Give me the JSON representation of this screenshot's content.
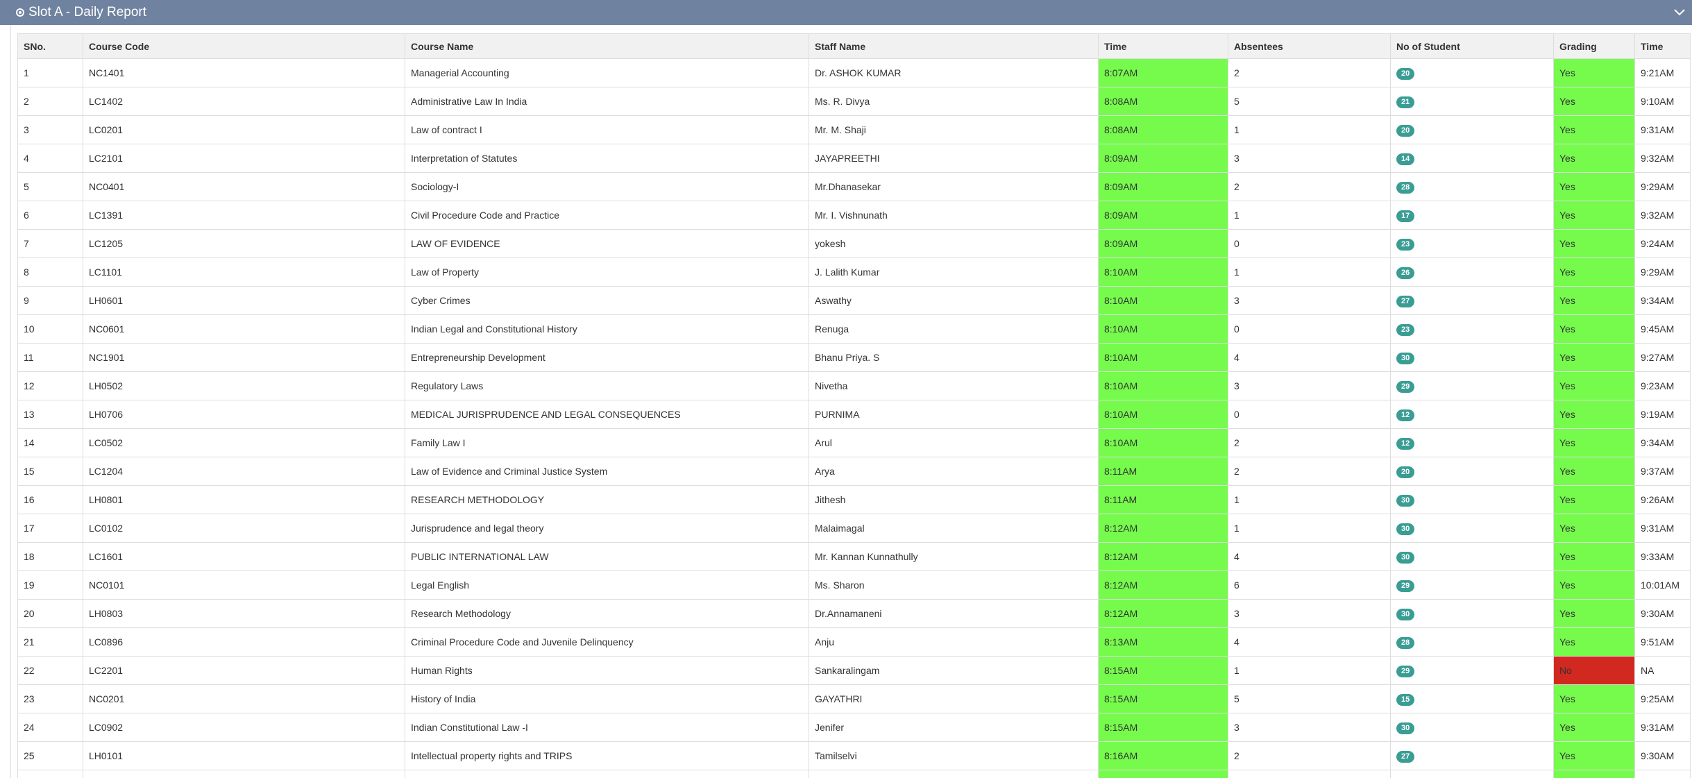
{
  "panel": {
    "title": "Slot A - Daily Report"
  },
  "colors": {
    "header_bg": "#6f829f",
    "on_time": "#76fb4d",
    "grading_no": "#d1281f",
    "badge": "#3a9d94"
  },
  "table": {
    "headers": [
      "SNo.",
      "Course Code",
      "Course Name",
      "Staff Name",
      "Time",
      "Absentees",
      "No of Student",
      "Grading",
      "Time"
    ],
    "rows": [
      {
        "sno": "1",
        "code": "NC1401",
        "name": "Managerial Accounting",
        "staff": "Dr. ASHOK KUMAR",
        "time": "8:07AM",
        "absentees": "2",
        "students": "20",
        "grading": "Yes",
        "grading_time": "9:21AM"
      },
      {
        "sno": "2",
        "code": "LC1402",
        "name": "Administrative Law In India",
        "staff": "Ms. R. Divya",
        "time": "8:08AM",
        "absentees": "5",
        "students": "21",
        "grading": "Yes",
        "grading_time": "9:10AM"
      },
      {
        "sno": "3",
        "code": "LC0201",
        "name": "Law of contract I",
        "staff": "Mr. M. Shaji",
        "time": "8:08AM",
        "absentees": "1",
        "students": "20",
        "grading": "Yes",
        "grading_time": "9:31AM"
      },
      {
        "sno": "4",
        "code": "LC2101",
        "name": "Interpretation of Statutes",
        "staff": "JAYAPREETHI",
        "time": "8:09AM",
        "absentees": "3",
        "students": "14",
        "grading": "Yes",
        "grading_time": "9:32AM"
      },
      {
        "sno": "5",
        "code": "NC0401",
        "name": "Sociology-I",
        "staff": "Mr.Dhanasekar",
        "time": "8:09AM",
        "absentees": "2",
        "students": "28",
        "grading": "Yes",
        "grading_time": "9:29AM"
      },
      {
        "sno": "6",
        "code": "LC1391",
        "name": "Civil Procedure Code and Practice",
        "staff": "Mr. I. Vishnunath",
        "time": "8:09AM",
        "absentees": "1",
        "students": "17",
        "grading": "Yes",
        "grading_time": "9:32AM"
      },
      {
        "sno": "7",
        "code": "LC1205",
        "name": "LAW OF EVIDENCE",
        "staff": "yokesh",
        "time": "8:09AM",
        "absentees": "0",
        "students": "23",
        "grading": "Yes",
        "grading_time": "9:24AM"
      },
      {
        "sno": "8",
        "code": "LC1101",
        "name": "Law of Property",
        "staff": "J. Lalith Kumar",
        "time": "8:10AM",
        "absentees": "1",
        "students": "26",
        "grading": "Yes",
        "grading_time": "9:29AM"
      },
      {
        "sno": "9",
        "code": "LH0601",
        "name": "Cyber Crimes",
        "staff": "Aswathy",
        "time": "8:10AM",
        "absentees": "3",
        "students": "27",
        "grading": "Yes",
        "grading_time": "9:34AM"
      },
      {
        "sno": "10",
        "code": "NC0601",
        "name": "Indian Legal and Constitutional History",
        "staff": "Renuga",
        "time": "8:10AM",
        "absentees": "0",
        "students": "23",
        "grading": "Yes",
        "grading_time": "9:45AM"
      },
      {
        "sno": "11",
        "code": "NC1901",
        "name": "Entrepreneurship Development",
        "staff": "Bhanu Priya. S",
        "time": "8:10AM",
        "absentees": "4",
        "students": "30",
        "grading": "Yes",
        "grading_time": "9:27AM"
      },
      {
        "sno": "12",
        "code": "LH0502",
        "name": "Regulatory Laws",
        "staff": "Nivetha",
        "time": "8:10AM",
        "absentees": "3",
        "students": "29",
        "grading": "Yes",
        "grading_time": "9:23AM"
      },
      {
        "sno": "13",
        "code": "LH0706",
        "name": "MEDICAL JURISPRUDENCE AND LEGAL CONSEQUENCES",
        "staff": "PURNIMA",
        "time": "8:10AM",
        "absentees": "0",
        "students": "12",
        "grading": "Yes",
        "grading_time": "9:19AM"
      },
      {
        "sno": "14",
        "code": "LC0502",
        "name": "Family Law I",
        "staff": "Arul",
        "time": "8:10AM",
        "absentees": "2",
        "students": "12",
        "grading": "Yes",
        "grading_time": "9:34AM"
      },
      {
        "sno": "15",
        "code": "LC1204",
        "name": "Law of Evidence and Criminal Justice System",
        "staff": "Arya",
        "time": "8:11AM",
        "absentees": "2",
        "students": "20",
        "grading": "Yes",
        "grading_time": "9:37AM"
      },
      {
        "sno": "16",
        "code": "LH0801",
        "name": "RESEARCH METHODOLOGY",
        "staff": "Jithesh",
        "time": "8:11AM",
        "absentees": "1",
        "students": "30",
        "grading": "Yes",
        "grading_time": "9:26AM"
      },
      {
        "sno": "17",
        "code": "LC0102",
        "name": "Jurisprudence and legal theory",
        "staff": "Malaimagal",
        "time": "8:12AM",
        "absentees": "1",
        "students": "30",
        "grading": "Yes",
        "grading_time": "9:31AM"
      },
      {
        "sno": "18",
        "code": "LC1601",
        "name": "PUBLIC INTERNATIONAL LAW",
        "staff": "Mr. Kannan Kunnathully",
        "time": "8:12AM",
        "absentees": "4",
        "students": "30",
        "grading": "Yes",
        "grading_time": "9:33AM"
      },
      {
        "sno": "19",
        "code": "NC0101",
        "name": "Legal English",
        "staff": "Ms. Sharon",
        "time": "8:12AM",
        "absentees": "6",
        "students": "29",
        "grading": "Yes",
        "grading_time": "10:01AM"
      },
      {
        "sno": "20",
        "code": "LH0803",
        "name": "Research Methodology",
        "staff": "Dr.Annamaneni",
        "time": "8:12AM",
        "absentees": "3",
        "students": "30",
        "grading": "Yes",
        "grading_time": "9:30AM"
      },
      {
        "sno": "21",
        "code": "LC0896",
        "name": "Criminal Procedure Code and Juvenile Delinquency",
        "staff": "Anju",
        "time": "8:13AM",
        "absentees": "4",
        "students": "28",
        "grading": "Yes",
        "grading_time": "9:51AM"
      },
      {
        "sno": "22",
        "code": "LC2201",
        "name": "Human Rights",
        "staff": "Sankaralingam",
        "time": "8:15AM",
        "absentees": "1",
        "students": "29",
        "grading": "No",
        "grading_time": "NA"
      },
      {
        "sno": "23",
        "code": "NC0201",
        "name": "History of India",
        "staff": "GAYATHRI",
        "time": "8:15AM",
        "absentees": "5",
        "students": "15",
        "grading": "Yes",
        "grading_time": "9:25AM"
      },
      {
        "sno": "24",
        "code": "LC0902",
        "name": "Indian Constitutional Law -I",
        "staff": "Jenifer",
        "time": "8:15AM",
        "absentees": "3",
        "students": "30",
        "grading": "Yes",
        "grading_time": "9:31AM"
      },
      {
        "sno": "25",
        "code": "LH0101",
        "name": "Intellectual property rights and TRIPS",
        "staff": "Tamilselvi",
        "time": "8:16AM",
        "absentees": "2",
        "students": "27",
        "grading": "Yes",
        "grading_time": "9:30AM"
      }
    ]
  }
}
